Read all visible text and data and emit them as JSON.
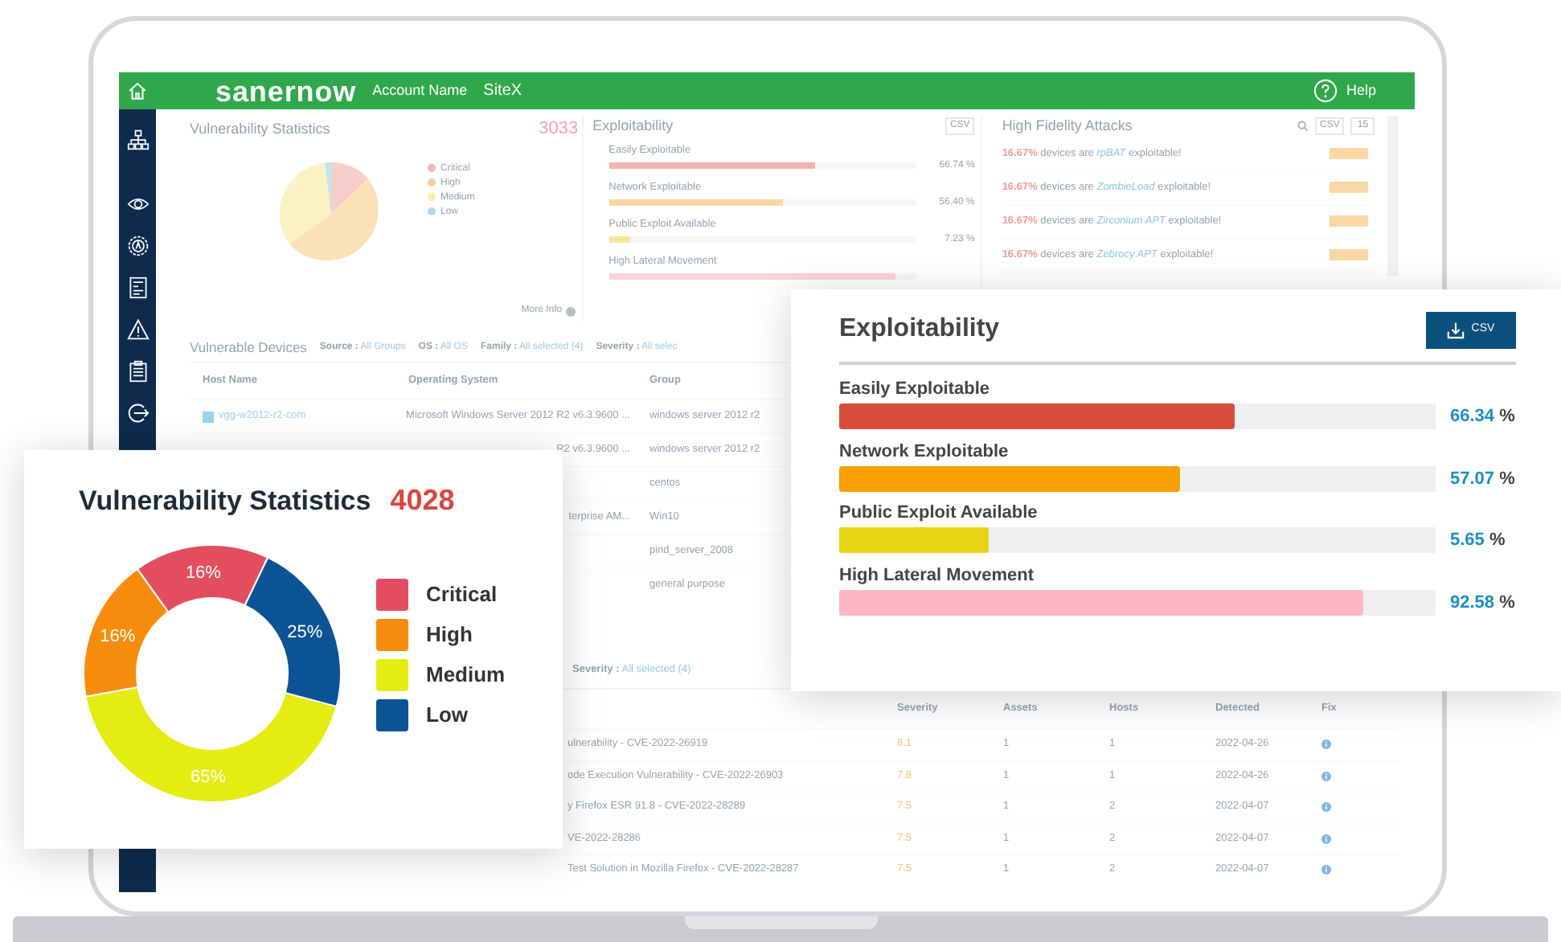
{
  "header": {
    "logo": "sanernow",
    "account": "Account Name",
    "site": "SiteX",
    "help": "Help"
  },
  "background_dashboard": {
    "vulnerability_statistics": {
      "title": "Vulnerability Statistics",
      "total": "3033",
      "more_info": "More Info",
      "legend": [
        {
          "label": "Critical",
          "color": "#f3b5b5"
        },
        {
          "label": "High",
          "color": "#f8cf9e"
        },
        {
          "label": "Medium",
          "color": "#f8eda6"
        },
        {
          "label": "Low",
          "color": "#a9dcf2"
        }
      ]
    },
    "exploitability": {
      "title": "Exploitability",
      "csv": "CSV",
      "items": [
        {
          "label": "Easily Exploitable",
          "level": 0.6674,
          "value": "66.74 %",
          "color": "#f3b0b0"
        },
        {
          "label": "Network Exploitable",
          "level": 0.564,
          "value": "56.40 %",
          "color": "#f8d6a5"
        },
        {
          "label": "Public Exploit Available",
          "level": 0.0723,
          "value": "7.23 %",
          "color": "#f6e79a"
        },
        {
          "label": "High Lateral Movement",
          "level": 0.93,
          "color": "#fbd3da"
        }
      ]
    },
    "high_fidelity_attacks": {
      "title": "High Fidelity Attacks",
      "csv": "CSV",
      "page_size": "15",
      "rows": [
        {
          "percent": "16.67%",
          "text": "devices are",
          "attack": "rpBAT",
          "suffix": "exploitable!"
        },
        {
          "percent": "16.67%",
          "text": "devices are",
          "attack": "ZombieLoad",
          "suffix": "exploitable!"
        },
        {
          "percent": "16.67%",
          "text": "devices are",
          "attack": "Zirconium APT",
          "suffix": "exploitable!"
        },
        {
          "percent": "16.67%",
          "text": "devices are",
          "attack": "Zebrocy APT",
          "suffix": "exploitable!"
        }
      ]
    },
    "vulnerable_devices": {
      "title": "Vulnerable Devices",
      "filters": [
        {
          "label": "Source :",
          "value": "All Groups"
        },
        {
          "label": "OS :",
          "value": "All OS"
        },
        {
          "label": "Family :",
          "value": "All selected (4)"
        },
        {
          "label": "Severity :",
          "value": "All selec"
        }
      ],
      "columns": [
        "Host Name",
        "Operating System",
        "Group"
      ],
      "rows": [
        {
          "host": "vgg-w2012-r2-com",
          "os": "Microsoft Windows Server 2012 R2 v6.3.9600 ...",
          "group": "windows server 2012 r2"
        },
        {
          "os": "R2 v6.3.9600 ...",
          "group": "windows server 2012 r2"
        },
        {
          "group": "centos"
        },
        {
          "os": "terprise AM...",
          "group": "Win10"
        },
        {
          "group": "pind_server_2008"
        },
        {
          "group": "general purpose"
        }
      ]
    },
    "vulnerabilities": {
      "filter": {
        "label": "Severity :",
        "value": "All selected (4)"
      },
      "columns": [
        "Severity",
        "Assets",
        "Hosts",
        "Detected",
        "Fix"
      ],
      "rows": [
        {
          "name": "ulnerability - CVE-2022-26919",
          "severity": "8.1",
          "assets": "1",
          "hosts": "1",
          "detected": "2022-04-26"
        },
        {
          "name": "ode Execution Vulnerability - CVE-2022-26903",
          "severity": "7.8",
          "assets": "1",
          "hosts": "1",
          "detected": "2022-04-26"
        },
        {
          "name": "y Firefox ESR 91.8 - CVE-2022-28289",
          "severity": "7.5",
          "assets": "1",
          "hosts": "2",
          "detected": "2022-04-07"
        },
        {
          "name": "VE-2022-28286",
          "severity": "7.5",
          "assets": "1",
          "hosts": "2",
          "detected": "2022-04-07"
        },
        {
          "name": "Test Solution in Mozilla Firefox - CVE-2022-28287",
          "severity": "7.5",
          "assets": "1",
          "hosts": "2",
          "detected": "2022-04-07"
        }
      ]
    }
  },
  "stats_card": {
    "title": "Vulnerability Statistics",
    "total": "4028",
    "chart_data": {
      "type": "donut",
      "categories": [
        "Critical",
        "High",
        "Medium",
        "Low"
      ],
      "series": [
        {
          "values": [
            17,
            18,
            43,
            22
          ]
        }
      ],
      "value_labels": [
        "16%",
        "16%",
        "65%",
        "25%"
      ],
      "colors": [
        "#e34e5f",
        "#f78c0c",
        "#e4ec12",
        "#0b5394"
      ]
    }
  },
  "exploitability_card": {
    "title": "Exploitability",
    "csv": "CSV",
    "items": [
      {
        "label": "Easily Exploitable",
        "level": 0.6634,
        "value": "66.34",
        "unit": "%",
        "color": "#d84c3c"
      },
      {
        "label": "Network Exploitable",
        "level": 0.5707,
        "value": "57.07",
        "unit": "%",
        "color": "#f8a000"
      },
      {
        "label": "Public Exploit Available",
        "level": 0.25,
        "value": "5.65",
        "unit": "%",
        "color": "#e8d414"
      },
      {
        "label": "High Lateral Movement",
        "level": 0.88,
        "value": "92.58",
        "unit": "%",
        "color": "#ffb6c3"
      }
    ]
  }
}
